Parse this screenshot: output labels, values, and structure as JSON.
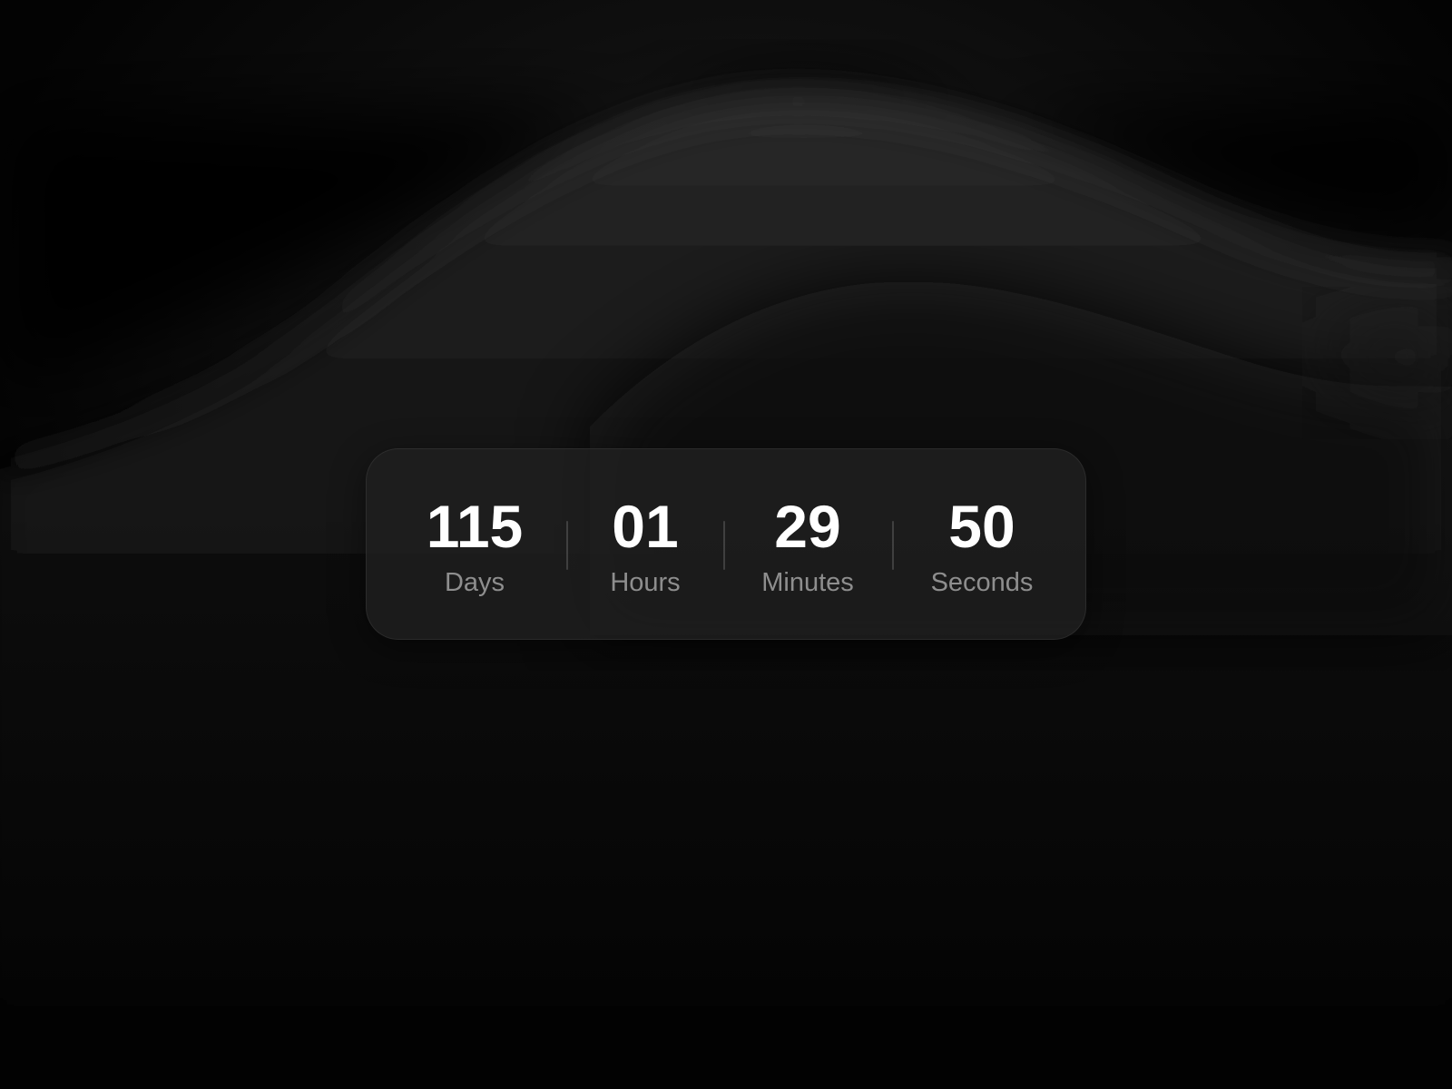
{
  "countdown": {
    "units": [
      {
        "value": "115",
        "label": "Days"
      },
      {
        "value": "01",
        "label": "Hours"
      },
      {
        "value": "29",
        "label": "Minutes"
      },
      {
        "value": "50",
        "label": "Seconds"
      }
    ]
  },
  "colors": {
    "background": "#030303",
    "card": "#202020",
    "value_text": "#ffffff",
    "label_text": "#8e8e8e"
  }
}
